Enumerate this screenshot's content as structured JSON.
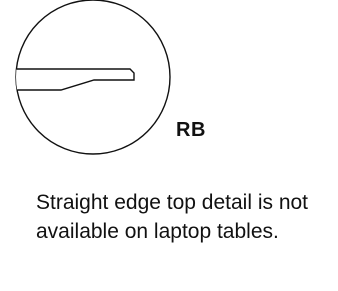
{
  "detail": {
    "code": "RB",
    "note": "Straight edge top detail is not available on laptop tables.",
    "line_color": "#111111",
    "fill_color": "#ffffff"
  },
  "icons": {
    "profile": "edge-profile-section-icon"
  }
}
